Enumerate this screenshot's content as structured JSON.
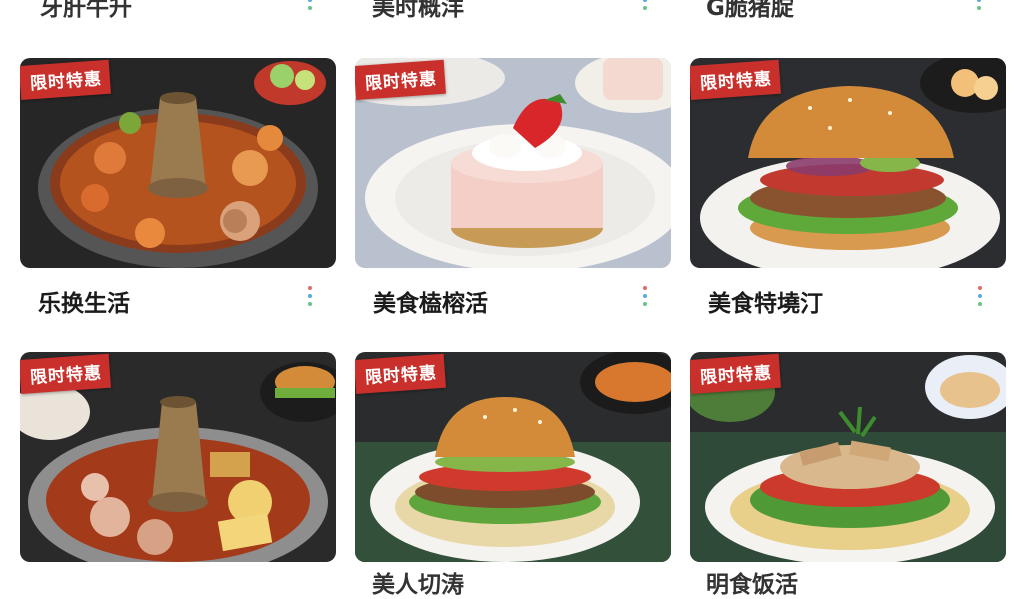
{
  "clipped_top_titles": [
    "牙肝牛升",
    "美时概洋",
    "G脆猪腚"
  ],
  "clipped_bottom_titles": [
    "美人切涛",
    "明食饭活"
  ],
  "badge_text": "限时特惠",
  "cards": [
    {
      "title": "乐换生活",
      "dish": "hotpot"
    },
    {
      "title": "美食榼榕活",
      "dish": "strawberry-cake"
    },
    {
      "title": "美食特墝汀",
      "dish": "burger"
    },
    {
      "title": "",
      "dish": "hotpot"
    },
    {
      "title": "",
      "dish": "burger-salad"
    },
    {
      "title": "",
      "dish": "chicken-salad"
    }
  ],
  "colors": {
    "badge": "#c9302c",
    "background": "#ffffff"
  }
}
